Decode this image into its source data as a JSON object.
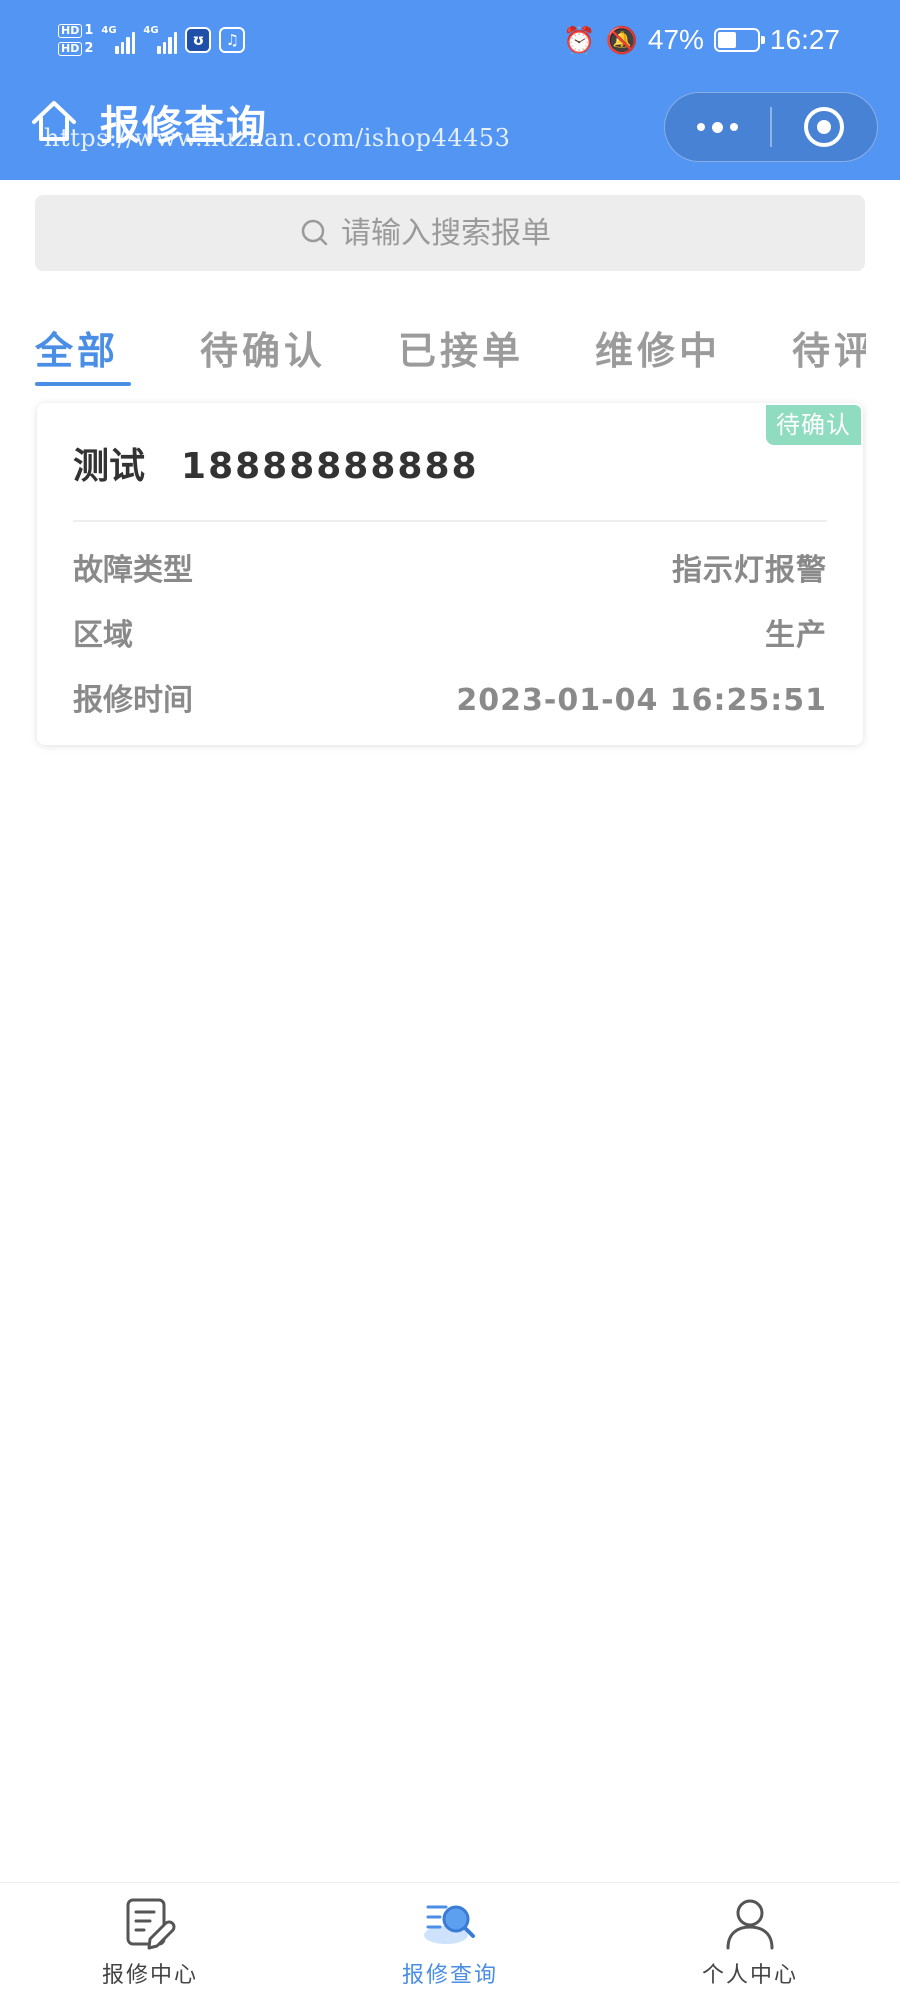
{
  "status_bar": {
    "sim1": "HD",
    "sim1_num": "1",
    "sim2": "HD",
    "sim2_num": "2",
    "network_1": "4G",
    "network_2": "4G",
    "battery_percent": "47%",
    "battery_level": 0.47,
    "time": "16:27"
  },
  "nav": {
    "title": "报修查询",
    "watermark": "https://www.huzhan.com/ishop44453",
    "icons": [
      "home-icon",
      "more-dots-icon",
      "close-target-icon"
    ]
  },
  "search": {
    "placeholder": "请输入搜索报单"
  },
  "tabs": [
    {
      "label": "全部",
      "active": true
    },
    {
      "label": "待确认",
      "active": false
    },
    {
      "label": "已接单",
      "active": false
    },
    {
      "label": "维修中",
      "active": false
    },
    {
      "label": "待评",
      "active": false
    }
  ],
  "order": {
    "status": "待确认",
    "name": "测试",
    "phone": "18888888888",
    "rows": [
      {
        "label": "故障类型",
        "value": "指示灯报警"
      },
      {
        "label": "区域",
        "value": "生产"
      },
      {
        "label": "报修时间",
        "value": "2023-01-04 16:25:51"
      }
    ]
  },
  "tabbar": [
    {
      "label": "报修中心",
      "icon": "repair-form-icon",
      "active": false
    },
    {
      "label": "报修查询",
      "icon": "search-list-icon",
      "active": true
    },
    {
      "label": "个人中心",
      "icon": "user-icon",
      "active": false
    }
  ],
  "colors": {
    "header": "#5395f3",
    "accent": "#4a8ee5",
    "status_badge": "#8fdcc0",
    "muted_text": "#8a8a8a"
  }
}
